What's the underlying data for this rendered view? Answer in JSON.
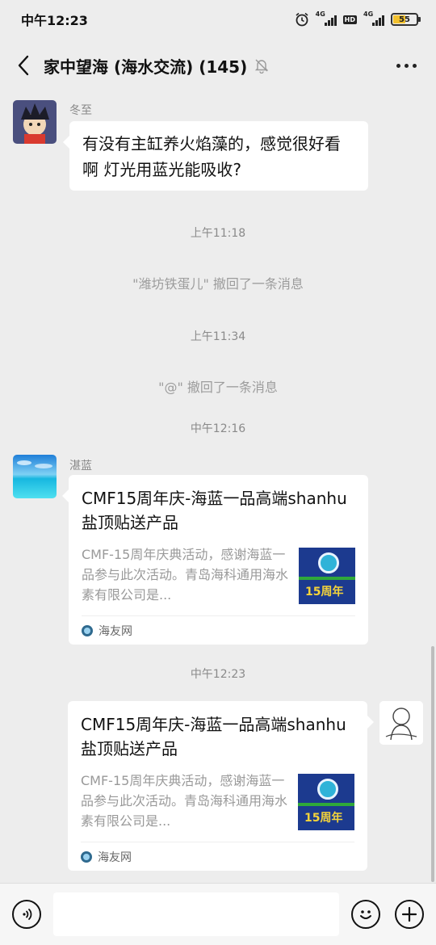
{
  "status_bar": {
    "time": "中午12:23",
    "icons": [
      "alarm-icon",
      "signal-4g-icon",
      "hd-icon",
      "signal-4g-icon",
      "battery-icon"
    ],
    "network_label": "4G",
    "hd_label": "HD",
    "battery": "55"
  },
  "header": {
    "title": "家中望海 (海水交流) (145)",
    "back_icon": "chevron-left-icon",
    "muted_icon": "bell-off-icon",
    "more_icon": "more-dots-icon"
  },
  "messages": [
    {
      "type": "text",
      "sender": "冬至",
      "text": "有没有主缸养火焰藻的，感觉很好看啊 灯光用蓝光能吸收?"
    },
    {
      "type": "timestamp",
      "text": "上午11:18"
    },
    {
      "type": "system",
      "text": "\"潍坊铁蛋儿\" 撤回了一条消息"
    },
    {
      "type": "timestamp",
      "text": "上午11:34"
    },
    {
      "type": "system",
      "text": "\"@\" 撤回了一条消息"
    },
    {
      "type": "timestamp",
      "text": "中午12:16"
    },
    {
      "type": "link_card",
      "sender": "湛蓝",
      "title": "CMF15周年庆-海蓝一品高端shanhu盐顶贴送产品",
      "description": "CMF-15周年庆典活动，感谢海蓝一品参与此次活动。青岛海科通用海水素有限公司是...",
      "thumbnail_text": "15周年",
      "source": "海友网"
    },
    {
      "type": "timestamp",
      "text": "中午12:23"
    },
    {
      "type": "link_card",
      "sender": "",
      "title": "CMF15周年庆-海蓝一品高端shanhu盐顶贴送产品",
      "description": "CMF-15周年庆典活动，感谢海蓝一品参与此次活动。青岛海科通用海水素有限公司是...",
      "thumbnail_text": "15周年",
      "source": "海友网"
    }
  ],
  "input_bar": {
    "voice_icon": "voice-icon",
    "input_value": "",
    "emoji_icon": "emoji-icon",
    "add_icon": "plus-icon"
  },
  "colors": {
    "background": "#ededed",
    "bubble": "#ffffff",
    "timestamp": "#8a8a8a",
    "input_bar": "#f6f6f6"
  }
}
